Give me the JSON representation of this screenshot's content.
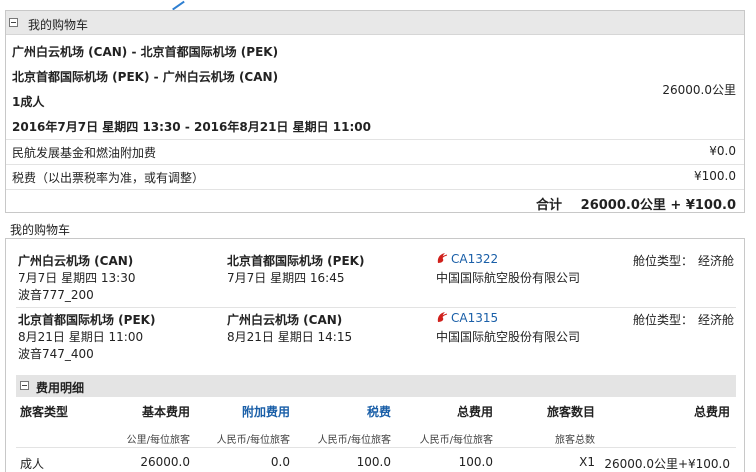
{
  "cart": {
    "title": "我的购物车",
    "route1": "广州白云机场 (CAN) - 北京首都国际机场 (PEK)",
    "route2": "北京首都国际机场 (PEK) - 广州白云机场 (CAN)",
    "passengers": "1成人",
    "dates": "2016年7月7日 星期四 13:30 - 2016年8月21日 星期日 11:00",
    "miles": "26000.0公里",
    "fuel_label": "民航发展基金和燃油附加费",
    "fuel_value": "¥0.0",
    "tax_label": "税费（以出票税率为准，或有调整）",
    "tax_value": "¥100.0",
    "total_label": "合计",
    "total_value": "26000.0公里 + ¥100.0"
  },
  "flights_title": "我的购物车",
  "flights": [
    {
      "from_airport": "广州白云机场 (CAN)",
      "from_time": "7月7日 星期四 13:30",
      "aircraft": "波音777_200",
      "to_airport": "北京首都国际机场 (PEK)",
      "to_time": "7月7日 星期四 16:45",
      "flight_no": "CA1322",
      "airline": "中国国际航空股份有限公司",
      "cabin_label": "舱位类型：",
      "cabin": "经济舱"
    },
    {
      "from_airport": "北京首都国际机场 (PEK)",
      "from_time": "8月21日 星期日 11:00",
      "aircraft": "波音747_400",
      "to_airport": "广州白云机场 (CAN)",
      "to_time": "8月21日 星期日 14:15",
      "flight_no": "CA1315",
      "airline": "中国国际航空股份有限公司",
      "cabin_label": "舱位类型：",
      "cabin": "经济舱"
    }
  ],
  "fees": {
    "title": "费用明细",
    "headers": [
      "旅客类型",
      "基本费用",
      "附加费用",
      "税费",
      "总费用",
      "旅客数目",
      "总费用"
    ],
    "subheaders": [
      "",
      "公里/每位旅客",
      "人民币/每位旅客",
      "人民币/每位旅客",
      "人民币/每位旅客",
      "旅客总数",
      ""
    ],
    "row": [
      "成人",
      "26000.0",
      "0.0",
      "100.0",
      "100.0",
      "X1",
      "26000.0公里+¥100.0"
    ]
  },
  "colors": {
    "link": "#1a5fa8",
    "header_bg": "#e8e8e8",
    "logo_red": "#d0211c"
  }
}
